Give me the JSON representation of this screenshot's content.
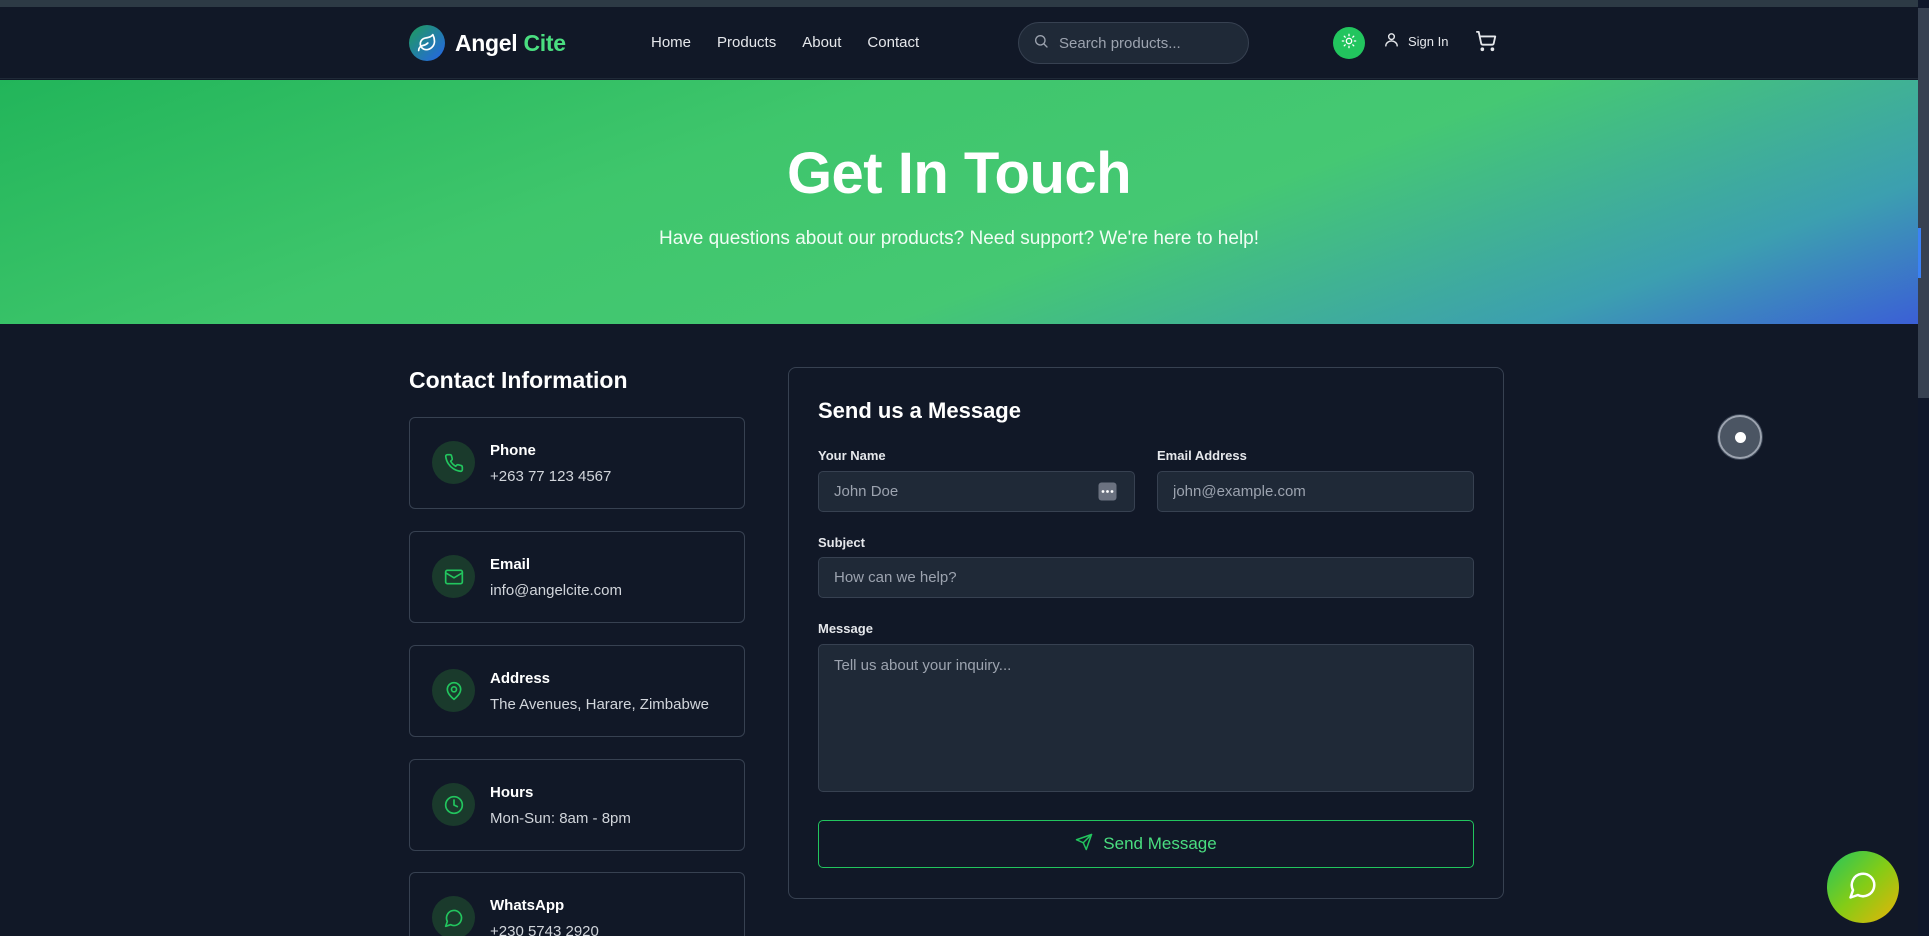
{
  "header": {
    "logo_part1": "Angel",
    "logo_part2": "Cite",
    "nav": [
      "Home",
      "Products",
      "About",
      "Contact"
    ],
    "search_placeholder": "Search products...",
    "signin_label": "Sign In"
  },
  "hero": {
    "title": "Get In Touch",
    "subtitle": "Have questions about our products? Need support? We're here to help!"
  },
  "contact_info": {
    "title": "Contact Information",
    "items": [
      {
        "label": "Phone",
        "value": "+263 77 123 4567",
        "icon": "phone-icon"
      },
      {
        "label": "Email",
        "value": "info@angelcite.com",
        "icon": "mail-icon"
      },
      {
        "label": "Address",
        "value": "The Avenues, Harare, Zimbabwe",
        "icon": "map-pin-icon"
      },
      {
        "label": "Hours",
        "value": "Mon-Sun: 8am - 8pm",
        "icon": "clock-icon"
      },
      {
        "label": "WhatsApp",
        "value": "+230 5743 2920",
        "icon": "chat-icon"
      }
    ]
  },
  "form": {
    "title": "Send us a Message",
    "name_label": "Your Name",
    "name_placeholder": "John Doe",
    "email_label": "Email Address",
    "email_placeholder": "john@example.com",
    "subject_label": "Subject",
    "subject_placeholder": "How can we help?",
    "message_label": "Message",
    "message_placeholder": "Tell us about your inquiry...",
    "send_label": "Send Message"
  },
  "colors": {
    "accent": "#22c55e",
    "background": "#111827",
    "card_border": "#374151"
  }
}
